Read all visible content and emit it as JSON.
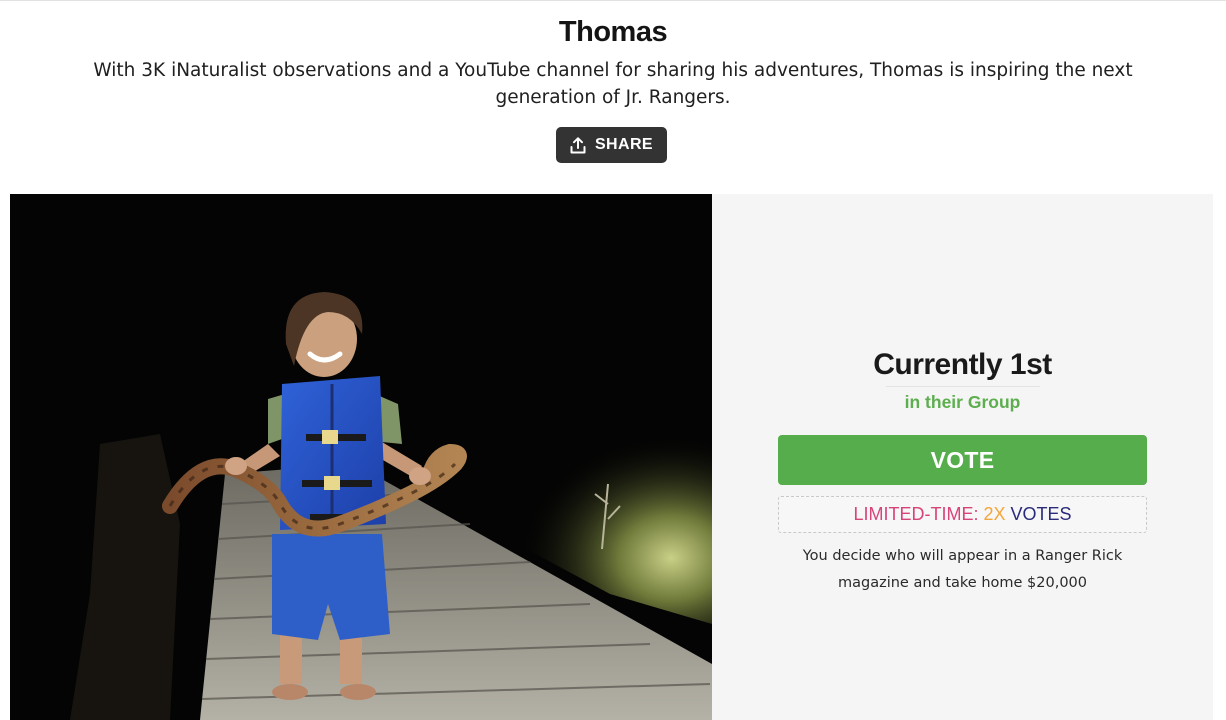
{
  "profile": {
    "name": "Thomas",
    "description": "With 3K iNaturalist observations and a YouTube channel for sharing his adventures, Thomas is inspiring the next generation of Jr. Rangers.",
    "share_label": "SHARE"
  },
  "standing": {
    "rank": "Currently 1st",
    "group": "in their Group",
    "vote_label": "VOTE",
    "promo_part1": "LIMITED-TIME: ",
    "promo_part2": "2X ",
    "promo_part3": "VOTES",
    "description": "You decide who will appear in a Ranger Rick magazine and take home $20,000"
  },
  "colors": {
    "vote_green": "#55ad4b",
    "group_green": "#5cae4f",
    "share_dark": "#333333",
    "promo_pink": "#d6447a",
    "promo_orange": "#f3a63a",
    "promo_navy": "#2a2b7b"
  },
  "icons": {
    "share": "share-upload-icon"
  }
}
